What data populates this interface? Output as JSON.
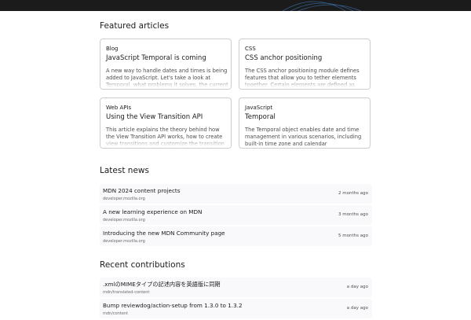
{
  "featured": {
    "title": "Featured articles",
    "cards": [
      {
        "category": "Blog",
        "title": "JavaScript Temporal is coming",
        "description": "A new way to handle dates and times is being added to JavaScript. Let's take a look at Temporal, what problems it solves, the current state, and what you'll find in the new MDN reference."
      },
      {
        "category": "CSS",
        "title": "CSS anchor positioning",
        "description": "The CSS anchor positioning module defines features that allow you to tether elements together. Certain elements are defined as anchor elements."
      },
      {
        "category": "Web APIs",
        "title": "Using the View Transition API",
        "description": "This article explains the theory behind how the View Transition API works, how to create view transitions and customize the transition animations."
      },
      {
        "category": "JavaScript",
        "title": "Temporal",
        "description": "The Temporal object enables date and time management in various scenarios, including built-in time zone and calendar"
      }
    ]
  },
  "news": {
    "title": "Latest news",
    "items": [
      {
        "title": "MDN 2024 content projects",
        "source": "developer.mozilla.org",
        "date": "2 months ago"
      },
      {
        "title": "A new learning experience on MDN",
        "source": "developer.mozilla.org",
        "date": "3 months ago"
      },
      {
        "title": "Introducing the new MDN Community page",
        "source": "developer.mozilla.org",
        "date": "5 months ago"
      }
    ]
  },
  "contributions": {
    "title": "Recent contributions",
    "items": [
      {
        "title": ".xmlのMIMEタイプの記述内容を英語版に同期",
        "source": "mdn/translated-content",
        "date": "a day ago"
      },
      {
        "title": "Bump reviewdog/action-setup from 1.3.0 to 1.3.2",
        "source": "mdn/content",
        "date": "a day ago"
      }
    ]
  }
}
